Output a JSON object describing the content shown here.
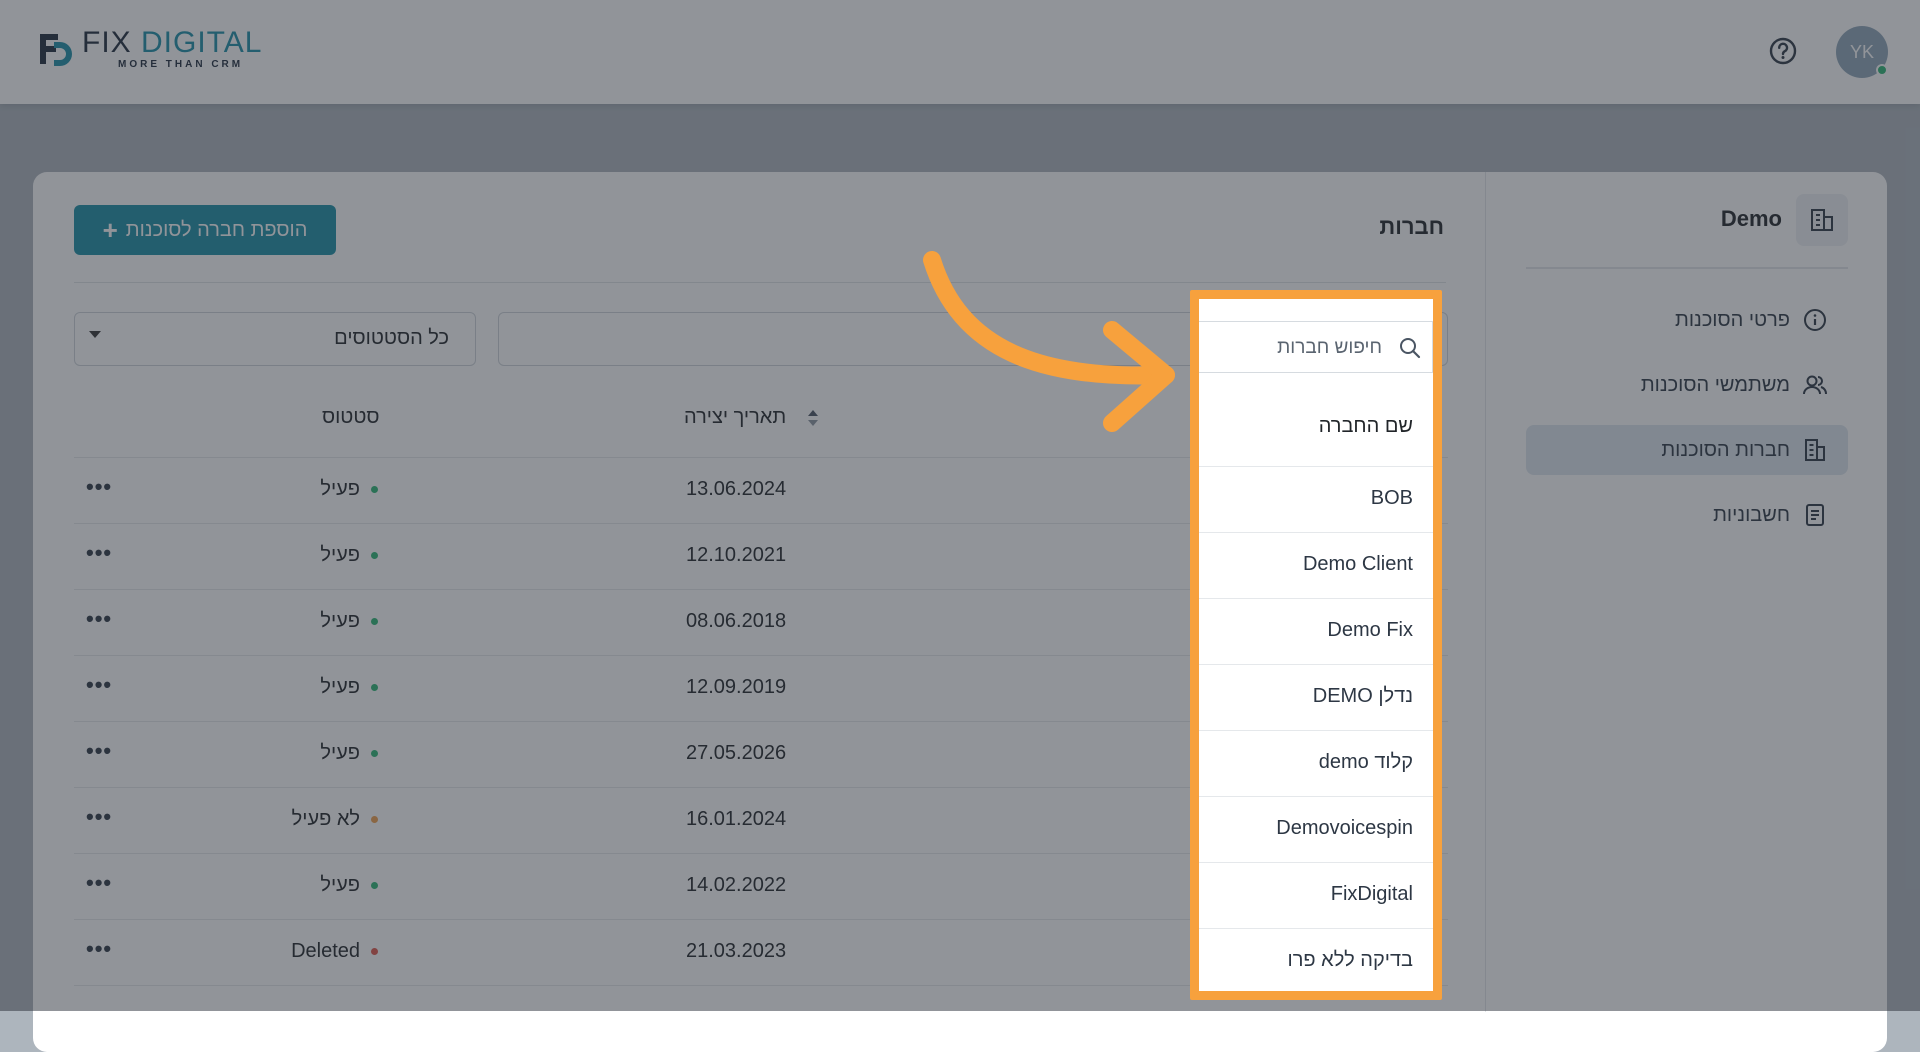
{
  "header": {
    "logo_fix": "FIX",
    "logo_digital": "DIGITAL",
    "logo_tagline": "MORE THAN CRM",
    "avatar_initials": "YK"
  },
  "sidebar": {
    "agency_name": "Demo",
    "items": [
      {
        "label": "פרטי הסוכנות",
        "icon": "info-icon"
      },
      {
        "label": "משתמשי הסוכנות",
        "icon": "users-icon"
      },
      {
        "label": "חברות הסוכנות",
        "icon": "building-icon",
        "active": true
      },
      {
        "label": "חשבוניות",
        "icon": "invoice-icon"
      }
    ]
  },
  "main": {
    "title": "חברות",
    "add_button_label": "הוספת חברה לסוכנות",
    "status_filter_value": "כל הסטטוסים",
    "search_placeholder": "חיפוש חברות",
    "columns": {
      "name": "שם החברה",
      "created": "תאריך יצירה",
      "status": "סטטוס"
    },
    "rows": [
      {
        "name": "BOB",
        "created": "13.06.2024",
        "status": "פעיל",
        "status_color": "#2bb673"
      },
      {
        "name": "Demo Client",
        "created": "12.10.2021",
        "status": "פעיל",
        "status_color": "#2bb673"
      },
      {
        "name": "Demo Fix",
        "created": "08.06.2018",
        "status": "פעיל",
        "status_color": "#2bb673"
      },
      {
        "name": "DEMO נדלן",
        "created": "12.09.2019",
        "status": "פעיל",
        "status_color": "#2bb673"
      },
      {
        "name": "demo קלוד",
        "created": "27.05.2026",
        "status": "פעיל",
        "status_color": "#2bb673"
      },
      {
        "name": "Demovoicespin",
        "created": "16.01.2024",
        "status": "לא פעיל",
        "status_color": "#f0a04b"
      },
      {
        "name": "FixDigital",
        "created": "14.02.2022",
        "status": "פעיל",
        "status_color": "#2bb673"
      },
      {
        "name": "בדיקה ללא פרו",
        "created": "21.03.2023",
        "status": "Deleted",
        "status_color": "#e0564a"
      }
    ]
  },
  "colors": {
    "accent": "#1b8ea6",
    "highlight": "#f7a13d",
    "active_nav": "#dde6ef"
  }
}
